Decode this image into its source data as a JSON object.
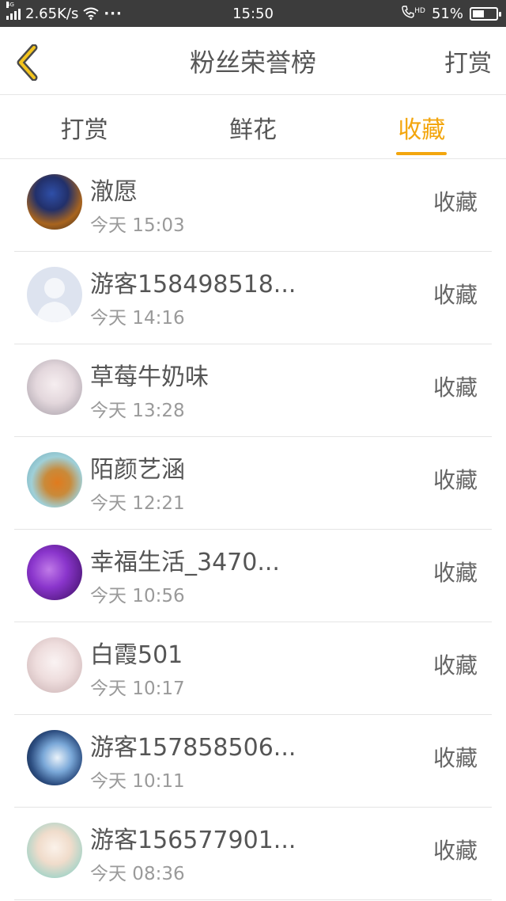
{
  "status_bar": {
    "network_type": "4G",
    "speed": "2.65K/s",
    "more": "···",
    "time": "15:50",
    "hd_tag": "HD",
    "battery": "51%",
    "battery_level": 0.51
  },
  "header": {
    "title": "粉丝荣誉榜",
    "action_label": "打赏",
    "back_icon": "chevron-left-icon",
    "accent_color": "#f3a60e"
  },
  "tabs": [
    {
      "label": "打赏",
      "active": false
    },
    {
      "label": "鲜花",
      "active": false
    },
    {
      "label": "收藏",
      "active": true
    }
  ],
  "fans": [
    {
      "name": "澈愿",
      "time": "今天 15:03",
      "action": "收藏"
    },
    {
      "name": "游客158498518...",
      "time": "今天 14:16",
      "action": "收藏"
    },
    {
      "name": "草莓牛奶味",
      "time": "今天 13:28",
      "action": "收藏"
    },
    {
      "name": "陌颜艺涵",
      "time": "今天 12:21",
      "action": "收藏"
    },
    {
      "name": "幸福生活_3470...",
      "time": "今天 10:56",
      "action": "收藏"
    },
    {
      "name": "白霞501",
      "time": "今天 10:17",
      "action": "收藏"
    },
    {
      "name": "游客157858506...",
      "time": "今天 10:11",
      "action": "收藏"
    },
    {
      "name": "游客156577901...",
      "time": "今天 08:36",
      "action": "收藏"
    }
  ]
}
